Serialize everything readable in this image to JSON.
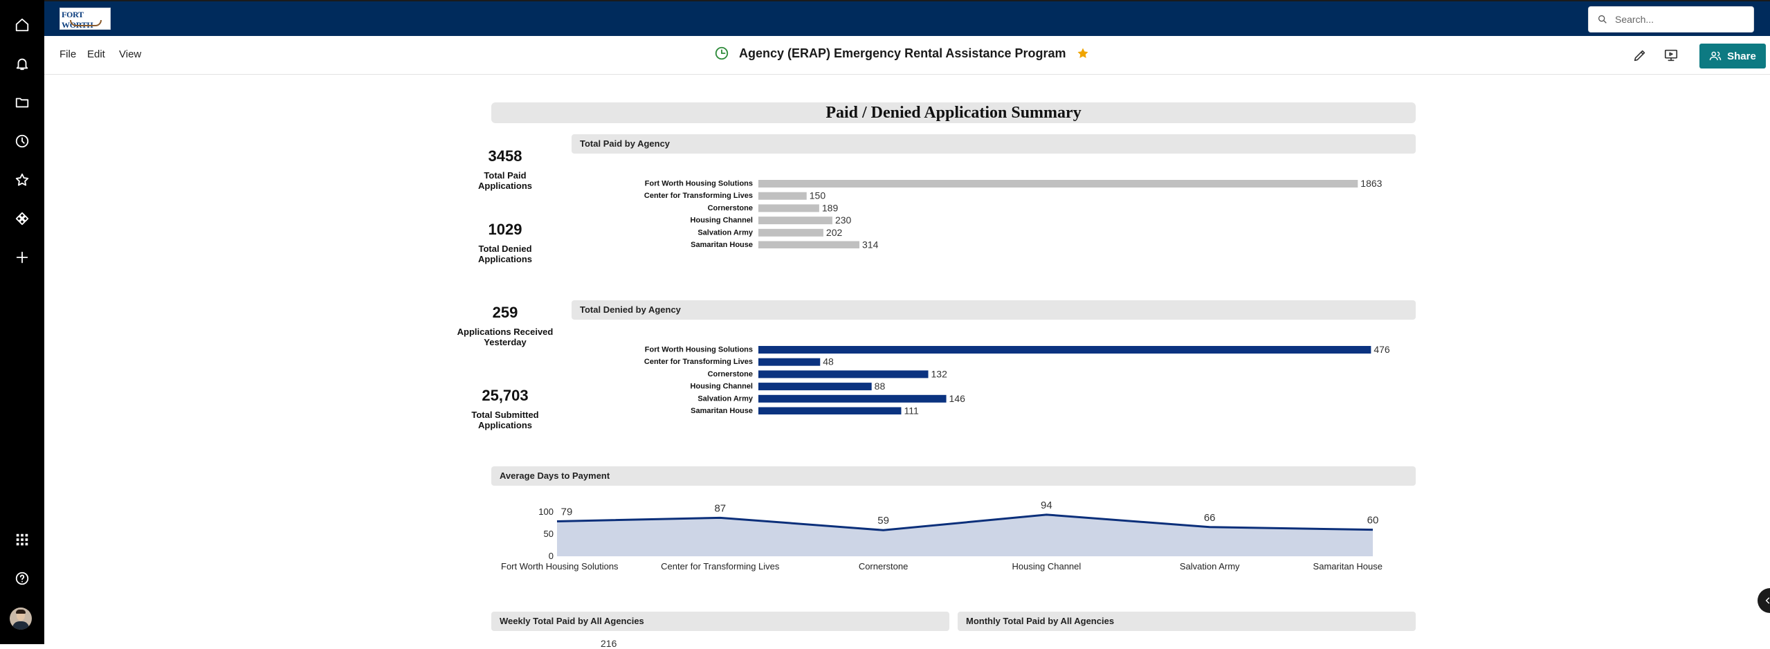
{
  "header": {
    "logo_text": "FORT WORTH",
    "search_placeholder": "Search..."
  },
  "menu": {
    "file": "File",
    "edit": "Edit",
    "view": "View"
  },
  "document": {
    "title": "Agency (ERAP) Emergency Rental Assistance Program"
  },
  "toolbar": {
    "share_label": "Share"
  },
  "colors": {
    "topbar": "#002b5c",
    "paid_bar": "#c0c0c0",
    "denied_bar": "#0b3380",
    "area_fill": "#cdd5e6",
    "area_line": "#0b2f7a",
    "share_button": "#0d7a82"
  },
  "report": {
    "section_title": "Paid / Denied Application Summary",
    "kpis": [
      {
        "value": "3458",
        "label": "Total Paid Applications"
      },
      {
        "value": "1029",
        "label": "Total Denied Applications"
      },
      {
        "value": "259",
        "label": "Applications Received Yesterday"
      },
      {
        "value": "25,703",
        "label": "Total Submitted Applications"
      }
    ],
    "panels": {
      "paid": "Total Paid by Agency",
      "denied": "Total Denied by Agency",
      "avg_days": "Average Days to Payment",
      "weekly": "Weekly Total Paid by All Agencies",
      "monthly": "Monthly Total Paid by All Agencies"
    },
    "weekly_peek_label": "216"
  },
  "chart_data": [
    {
      "type": "bar",
      "orientation": "horizontal",
      "title": "Total Paid by Agency",
      "categories": [
        "Fort Worth Housing Solutions",
        "Center for Transforming Lives",
        "Cornerstone",
        "Housing Channel",
        "Salvation Army",
        "Samaritan House"
      ],
      "values": [
        1863,
        150,
        189,
        230,
        202,
        314
      ],
      "xlim": [
        0,
        2000
      ],
      "ticks": [
        0,
        200,
        400,
        600,
        800,
        1000,
        1200,
        1400,
        1600,
        1800,
        2000
      ],
      "data_labels": true,
      "grid": false
    },
    {
      "type": "bar",
      "orientation": "horizontal",
      "title": "Total Denied by Agency",
      "categories": [
        "Fort Worth Housing Solutions",
        "Center for Transforming Lives",
        "Cornerstone",
        "Housing Channel",
        "Salvation Army",
        "Samaritan House"
      ],
      "values": [
        476,
        48,
        132,
        88,
        146,
        111
      ],
      "xlim": [
        0,
        500
      ],
      "ticks": [
        0,
        50,
        100,
        150,
        200,
        250,
        300,
        350,
        400,
        450,
        500
      ],
      "data_labels": true,
      "grid": false
    },
    {
      "type": "area",
      "title": "Average Days to Payment",
      "categories": [
        "Fort Worth Housing Solutions",
        "Center for Transforming Lives",
        "Cornerstone",
        "Housing Channel",
        "Salvation Army",
        "Samaritan House"
      ],
      "values": [
        79,
        87,
        59,
        94,
        66,
        60
      ],
      "ylim": [
        0,
        100
      ],
      "ticks": [
        0,
        50,
        100
      ],
      "data_labels": true,
      "grid": false
    }
  ]
}
